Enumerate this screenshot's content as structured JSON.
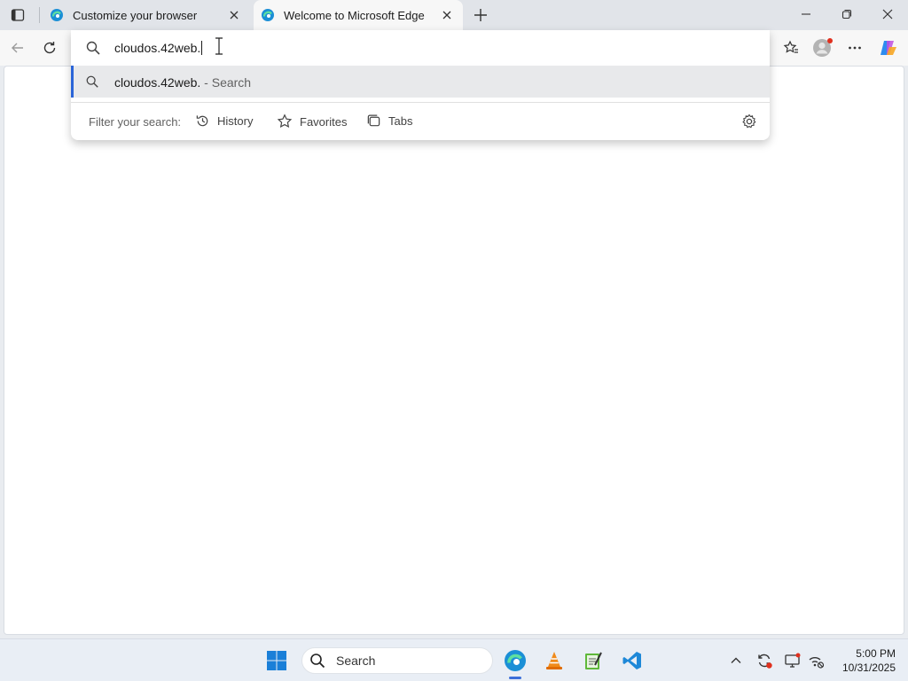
{
  "tabs": [
    {
      "title": "Customize your browser",
      "active": false,
      "favicon": "edge-logo-icon"
    },
    {
      "title": "Welcome to Microsoft Edge",
      "active": true,
      "favicon": "edge-logo-icon"
    }
  ],
  "omnibox": {
    "value": "cloudos.42web.",
    "suggestions": [
      {
        "text": "cloudos.42web.",
        "suffix": " - Search",
        "icon": "search-icon"
      }
    ],
    "filter": {
      "label": "Filter your search:",
      "chips": [
        {
          "label": "History",
          "icon": "history-icon"
        },
        {
          "label": "Favorites",
          "icon": "star-icon"
        },
        {
          "label": "Tabs",
          "icon": "tabs-icon"
        }
      ]
    }
  },
  "taskbar": {
    "search_label": "Search",
    "time": "5:00 PM",
    "date": "10/31/2025"
  },
  "colors": {
    "accent": "#2b65d8",
    "tabstrip": "#e1e4e9",
    "toolbar": "#f7f7f7"
  }
}
